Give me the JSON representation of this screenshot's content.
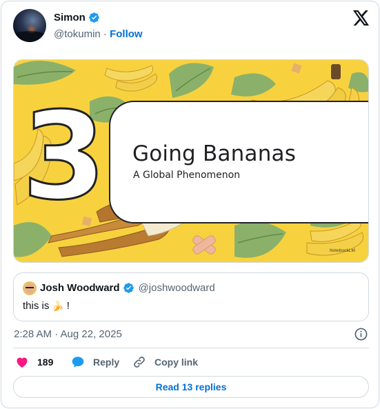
{
  "author": {
    "name": "Simon",
    "handle": "@tokumin",
    "separator": "·",
    "follow_label": "Follow"
  },
  "media": {
    "big_number": "3",
    "title": "Going Bananas",
    "subtitle": "A Global Phenomenon",
    "watermark": "NotebookLM",
    "background_color": "#f7d23e"
  },
  "quoted_tweet": {
    "name": "Josh Woodward",
    "handle": "@joshwoodward",
    "text": "this is",
    "emoji": "🍌",
    "text_suffix": "!"
  },
  "timestamp": "2:28 AM · Aug 22, 2025",
  "actions": {
    "likes_count": "189",
    "reply_label": "Reply",
    "copy_link_label": "Copy link"
  },
  "read_replies_label": "Read 13 replies",
  "colors": {
    "accent_blue": "#006fd6",
    "like_pink": "#f91880",
    "reply_blue": "#1d9bf0",
    "muted": "#536471"
  }
}
